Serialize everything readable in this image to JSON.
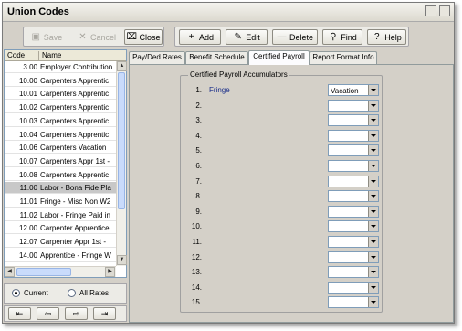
{
  "window": {
    "title": "Union Codes"
  },
  "toolbar_left": [
    {
      "label": "Save",
      "icon": "save-icon",
      "glyph": "▣",
      "disabled": true
    },
    {
      "label": "Cancel",
      "icon": "cancel-icon",
      "glyph": "✕",
      "disabled": true
    },
    {
      "label": "Close",
      "icon": "close-icon",
      "glyph": "⌧",
      "disabled": false
    }
  ],
  "toolbar_right": [
    {
      "label": "Add",
      "icon": "add-icon",
      "glyph": "+"
    },
    {
      "label": "Edit",
      "icon": "edit-icon",
      "glyph": "✎"
    },
    {
      "label": "Delete",
      "icon": "delete-icon",
      "glyph": "—"
    },
    {
      "label": "Find",
      "icon": "find-icon",
      "glyph": "⚲"
    },
    {
      "label": "Help",
      "icon": "help-icon",
      "glyph": "?"
    }
  ],
  "list": {
    "columns": [
      "Code",
      "Name"
    ],
    "rows": [
      {
        "code": "3.00",
        "name": "Employer Contribution"
      },
      {
        "code": "10.00",
        "name": "Carpenters Apprentic"
      },
      {
        "code": "10.01",
        "name": "Carpenters Apprentic"
      },
      {
        "code": "10.02",
        "name": "Carpenters Apprentic"
      },
      {
        "code": "10.03",
        "name": "Carpenters Apprentic"
      },
      {
        "code": "10.04",
        "name": "Carpenters Apprentic"
      },
      {
        "code": "10.06",
        "name": "Carpenters Vacation"
      },
      {
        "code": "10.07",
        "name": "Carpenters Appr 1st -"
      },
      {
        "code": "10.08",
        "name": "Carpenters Apprentic"
      },
      {
        "code": "11.00",
        "name": "Labor - Bona Fide Pla"
      },
      {
        "code": "11.01",
        "name": "Fringe - Misc Non W2"
      },
      {
        "code": "11.02",
        "name": "Labor - Fringe Paid in"
      },
      {
        "code": "12.00",
        "name": "Carpenter Apprentice"
      },
      {
        "code": "12.07",
        "name": "Carpenter Appr 1st -"
      },
      {
        "code": "14.00",
        "name": "Apprentice - Fringe W"
      }
    ],
    "selected_index": 9
  },
  "filter": {
    "options": [
      "Current",
      "All Rates"
    ],
    "selected": "Current"
  },
  "nav_buttons": [
    {
      "icon": "first-record-icon",
      "glyph": "⇤"
    },
    {
      "icon": "previous-record-icon",
      "glyph": "⇦"
    },
    {
      "icon": "next-record-icon",
      "glyph": "⇨"
    },
    {
      "icon": "last-record-icon",
      "glyph": "⇥"
    }
  ],
  "tabs": [
    {
      "label": "Pay/Ded Rates"
    },
    {
      "label": "Benefit Schedule"
    },
    {
      "label": "Certified Payroll",
      "active": true
    },
    {
      "label": "Report Format Info"
    }
  ],
  "accumulators": {
    "group_label": "Certified Payroll Accumulators",
    "rows": [
      {
        "num": "1.",
        "label": "Fringe",
        "value": "Vacation"
      },
      {
        "num": "2.",
        "label": "",
        "value": ""
      },
      {
        "num": "3.",
        "label": "",
        "value": ""
      },
      {
        "num": "4.",
        "label": "",
        "value": ""
      },
      {
        "num": "5.",
        "label": "",
        "value": ""
      },
      {
        "num": "6.",
        "label": "",
        "value": ""
      },
      {
        "num": "7.",
        "label": "",
        "value": ""
      },
      {
        "num": "8.",
        "label": "",
        "value": ""
      },
      {
        "num": "9.",
        "label": "",
        "value": ""
      },
      {
        "num": "10.",
        "label": "",
        "value": ""
      },
      {
        "num": "11.",
        "label": "",
        "value": ""
      },
      {
        "num": "12.",
        "label": "",
        "value": ""
      },
      {
        "num": "13.",
        "label": "",
        "value": ""
      },
      {
        "num": "14.",
        "label": "",
        "value": ""
      },
      {
        "num": "15.",
        "label": "",
        "value": ""
      }
    ]
  }
}
